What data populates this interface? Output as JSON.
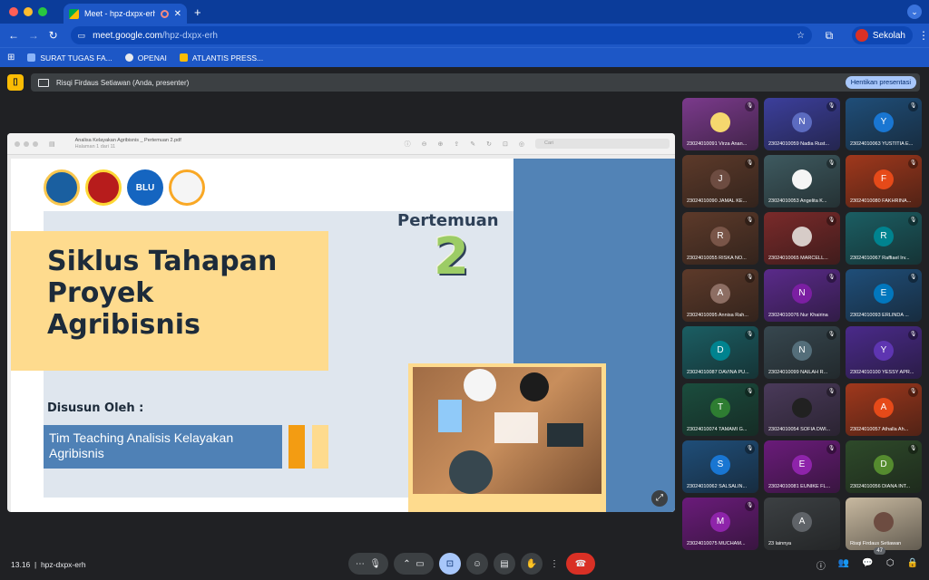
{
  "browser": {
    "tab_title": "Meet - hpz-dxpx-erh",
    "new_tab": "+",
    "url_host": "meet.google.com",
    "url_path": "/hpz-dxpx-erh",
    "profile_name": "Sekolah",
    "bookmarks": [
      {
        "label": "SURAT TUGAS FA...",
        "color": "#8ab4f8"
      },
      {
        "label": "OPENAI",
        "color": "#e8eaed"
      },
      {
        "label": "ATLANTIS PRESS...",
        "color": "#fbbc04"
      }
    ]
  },
  "presenter": {
    "text": "Risqi Firdaus Setiawan (Anda, presenter)",
    "stop_label": "Hentikan presentasi"
  },
  "pdf": {
    "filename": "Analisa Kelayakan Agribisnis _ Pertemuan 2.pdf",
    "page_info": "Halaman 1 dari 11",
    "search_placeholder": "Cari"
  },
  "slide": {
    "title_lines": [
      "Siklus Tahapan",
      "Proyek",
      "Agribisnis"
    ],
    "pertemuan": "Pertemuan",
    "number": "2",
    "disusun": "Disusun Oleh :",
    "team": "Tim Teaching Analisis Kelayakan Agribisnis",
    "logos": [
      "",
      "",
      "BLU",
      ""
    ]
  },
  "participants": [
    {
      "initial": "",
      "name": "23024010091 Virza Anan...",
      "bg": "#7b3a8c",
      "av": "#f5d76e"
    },
    {
      "initial": "N",
      "name": "23024010059 Nadia Rust...",
      "bg": "#3c3f9c",
      "av": "#5c6bc0"
    },
    {
      "initial": "Y",
      "name": "23024010063 YUSTITIA E...",
      "bg": "#1f4e79",
      "av": "#1976d2"
    },
    {
      "initial": "J",
      "name": "23024010090 JAMAL KE...",
      "bg": "#5d3a2a",
      "av": "#6d4c41"
    },
    {
      "initial": "",
      "name": "23024010053 Angelita K...",
      "bg": "#3e5a60",
      "av": "#f5f5f5"
    },
    {
      "initial": "F",
      "name": "23024010080 FAKHRINA...",
      "bg": "#a0381c",
      "av": "#e64a19"
    },
    {
      "initial": "R",
      "name": "23024010055 RISKA NO...",
      "bg": "#5d3a2a",
      "av": "#795548"
    },
    {
      "initial": "",
      "name": "23024010065 MARCELL...",
      "bg": "#7a2a2a",
      "av": "#d7ccc8"
    },
    {
      "initial": "R",
      "name": "23024010067 Raffiael Irv...",
      "bg": "#1b5e63",
      "av": "#00838f"
    },
    {
      "initial": "A",
      "name": "23024010095 Annisa Rah...",
      "bg": "#5d3a2a",
      "av": "#8d6e63"
    },
    {
      "initial": "N",
      "name": "23024010076 Nur Khairina",
      "bg": "#5a2a8a",
      "av": "#7b1fa2"
    },
    {
      "initial": "E",
      "name": "23024010093 ERLINDA ...",
      "bg": "#1f4e79",
      "av": "#0277bd"
    },
    {
      "initial": "D",
      "name": "23024010087 DAVINA PU...",
      "bg": "#1b5e63",
      "av": "#00838f"
    },
    {
      "initial": "N",
      "name": "23024010099 NAILAH R...",
      "bg": "#37474f",
      "av": "#546e7a"
    },
    {
      "initial": "Y",
      "name": "23024010100 YESSY APR...",
      "bg": "#4a2a8a",
      "av": "#5e35b1"
    },
    {
      "initial": "T",
      "name": "23024010074 TAMAMI G...",
      "bg": "#1b4d3e",
      "av": "#2e7d32"
    },
    {
      "initial": "",
      "name": "23024010054 SOFIA DWI...",
      "bg": "#4a3a5a",
      "av": "#212121"
    },
    {
      "initial": "A",
      "name": "23024010057 Athalla Ah...",
      "bg": "#a0381c",
      "av": "#e64a19"
    },
    {
      "initial": "S",
      "name": "23024010062 SALSALIN...",
      "bg": "#1f4e79",
      "av": "#1976d2"
    },
    {
      "initial": "E",
      "name": "23024010081 EUNIKE FL...",
      "bg": "#6a1b7a",
      "av": "#8e24aa"
    },
    {
      "initial": "D",
      "name": "23024010056 DIANA INT...",
      "bg": "#2e4a2a",
      "av": "#558b2f"
    },
    {
      "initial": "M",
      "name": "23024010075 MUCHAM...",
      "bg": "#6a1b7a",
      "av": "#8e24aa"
    },
    {
      "initial": "A",
      "name": "23 lainnya",
      "bg": "#3c4043",
      "av": "#5f6368"
    },
    {
      "initial": "",
      "name": "Risqi Firdaus Setiawan",
      "bg": "#c8b9a0",
      "av": "#6d4c41"
    }
  ],
  "bottom": {
    "time": "13.16",
    "meeting_code": "hpz-dxpx-erh",
    "participant_count": "47"
  }
}
